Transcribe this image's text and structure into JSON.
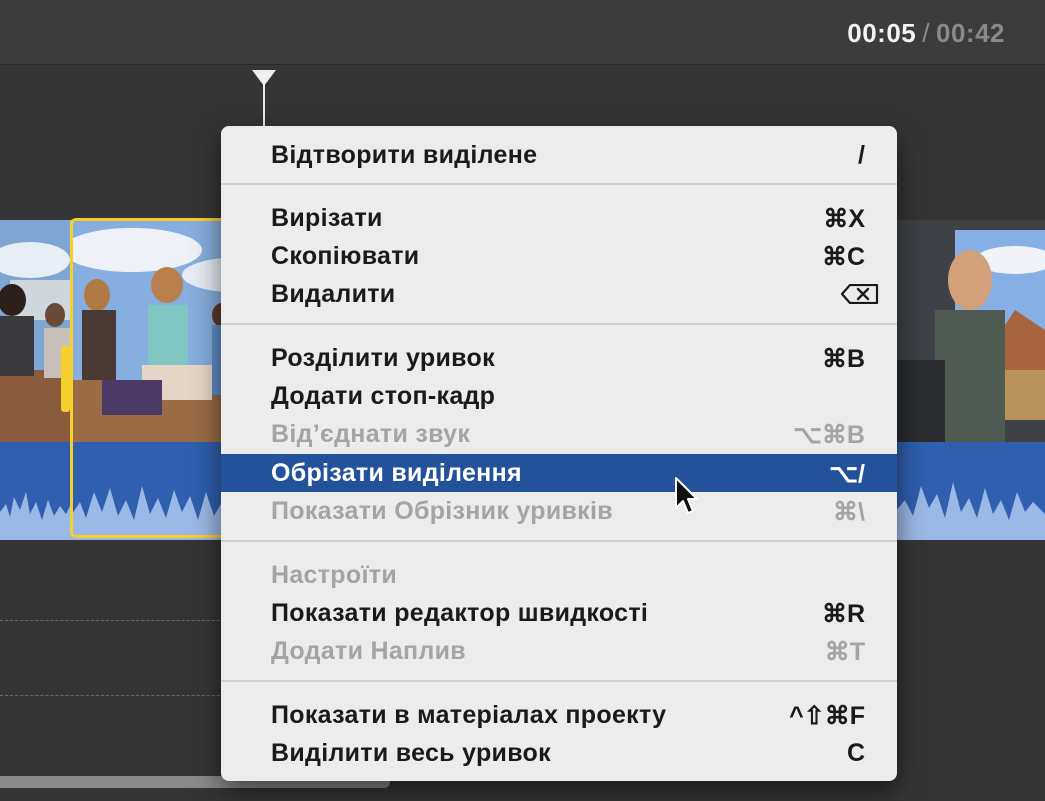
{
  "header": {
    "timecode_current": "00:05",
    "timecode_separator": "/",
    "timecode_total": "00:42"
  },
  "colors": {
    "menu_background": "#ececec",
    "menu_highlight": "#23529b",
    "selection_border": "#f7cf2c",
    "audio_waveform": "#2f5fae",
    "disabled_text": "#a4a4a4"
  },
  "context_menu": {
    "items": [
      {
        "label": "Відтворити виділене",
        "shortcut": "/",
        "state": "enabled"
      },
      {
        "label": "Вирізати",
        "shortcut": "⌘X",
        "state": "enabled"
      },
      {
        "label": "Скопіювати",
        "shortcut": "⌘C",
        "state": "enabled"
      },
      {
        "label": "Видалити",
        "shortcut_icon": "delete-key-icon",
        "state": "enabled"
      },
      {
        "label": "Розділити уривок",
        "shortcut": "⌘B",
        "state": "enabled"
      },
      {
        "label": "Додати стоп-кадр",
        "shortcut": "",
        "state": "enabled"
      },
      {
        "label": "Від’єднати звук",
        "shortcut": "⌥⌘B",
        "state": "disabled"
      },
      {
        "label": "Обрізати виділення",
        "shortcut": "⌥/",
        "state": "highlighted"
      },
      {
        "label": "Показати Обрізник уривків",
        "shortcut": "⌘\\",
        "state": "disabled"
      },
      {
        "label": "Настроїти",
        "shortcut": "",
        "state": "disabled"
      },
      {
        "label": "Показати редактор швидкості",
        "shortcut": "⌘R",
        "state": "enabled"
      },
      {
        "label": "Додати Наплив",
        "shortcut": "⌘T",
        "state": "disabled"
      },
      {
        "label": "Показати в матеріалах проекту",
        "shortcut": "^⇧⌘F",
        "state": "enabled"
      },
      {
        "label": "Виділити весь уривок",
        "shortcut": "C",
        "state": "enabled"
      }
    ]
  },
  "icons": {
    "playhead": "playhead-triangle-icon",
    "cursor": "mouse-pointer-icon",
    "delete_key": "delete-key-icon"
  }
}
